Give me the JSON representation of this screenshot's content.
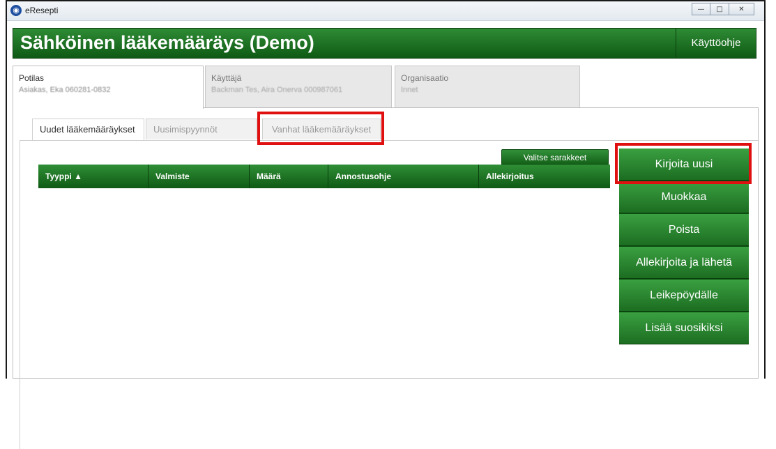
{
  "window": {
    "title": "eResepti",
    "minimize_icon": "minimize-icon",
    "maximize_icon": "maximize-icon",
    "close_icon": "close-icon"
  },
  "header": {
    "title": "Sähköinen lääkemääräys (Demo)",
    "help_label": "Käyttöohje"
  },
  "top_tabs": [
    {
      "label": "Potilas",
      "value": "Asiakas, Eka 060281-0832"
    },
    {
      "label": "Käyttäjä",
      "value": "Backman Tes, Aira Onerva 000987061"
    },
    {
      "label": "Organisaatio",
      "value": "Innet"
    }
  ],
  "sub_tabs": [
    {
      "label": "Uudet lääkemääräykset"
    },
    {
      "label": "Uusimispyynnöt"
    },
    {
      "label": "Vanhat lääkemääräykset"
    }
  ],
  "grid": {
    "select_columns_label": "Valitse sarakkeet",
    "columns": [
      "Tyyppi ▲",
      "Valmiste",
      "Määrä",
      "Annostusohje",
      "Allekirjoitus"
    ],
    "rows": []
  },
  "actions": [
    {
      "label": "Kirjoita uusi"
    },
    {
      "label": "Muokkaa"
    },
    {
      "label": "Poista"
    },
    {
      "label": "Allekirjoita ja lähetä"
    },
    {
      "label": "Leikepöydälle"
    },
    {
      "label": "Lisää suosikiksi"
    }
  ],
  "colors": {
    "brand_green": "#1f7a26",
    "highlight_red": "#e01010"
  }
}
